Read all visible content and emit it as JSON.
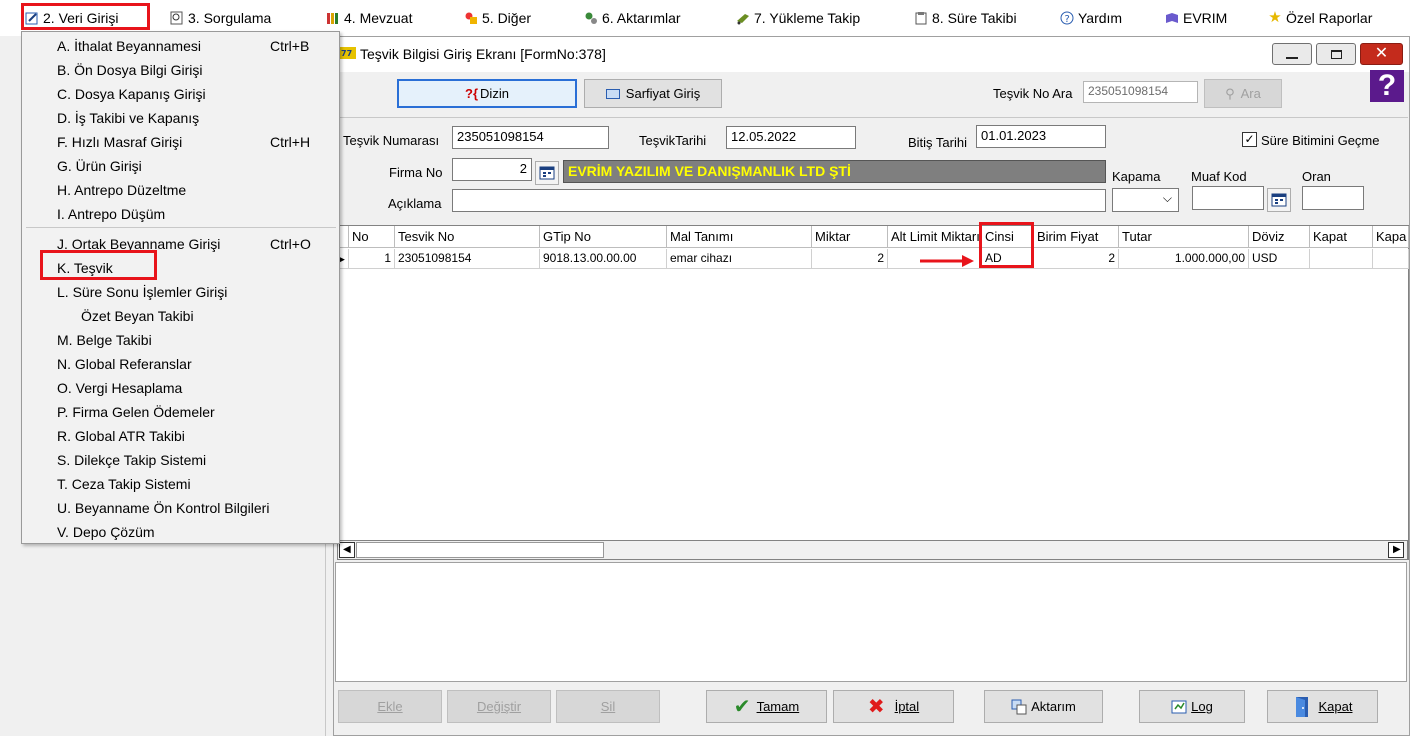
{
  "menubar": {
    "items": [
      {
        "label": "2.  Veri Girişi"
      },
      {
        "label": "3.  Sorgulama"
      },
      {
        "label": "4.  Mevzuat"
      },
      {
        "label": "5.  Diğer"
      },
      {
        "label": "6.  Aktarımlar"
      },
      {
        "label": "7.  Yükleme Takip"
      },
      {
        "label": "8. Süre Takibi"
      },
      {
        "label": "Yardım"
      },
      {
        "label": "EVRIM"
      },
      {
        "label": "Özel Raporlar"
      }
    ]
  },
  "dropdown": {
    "items": [
      {
        "label": "A.  İthalat Beyannamesi",
        "shortcut": "Ctrl+B"
      },
      {
        "label": "B.  Ön Dosya Bilgi Girişi",
        "shortcut": ""
      },
      {
        "label": "C.  Dosya Kapanış Girişi",
        "shortcut": ""
      },
      {
        "label": "D.  İş Takibi ve Kapanış",
        "shortcut": ""
      },
      {
        "label": "F.  Hızlı Masraf Girişi",
        "shortcut": "Ctrl+H"
      },
      {
        "label": "G.  Ürün Girişi",
        "shortcut": ""
      },
      {
        "label": "H.  Antrepo Düzeltme",
        "shortcut": ""
      },
      {
        "label": "I.  Antrepo Düşüm",
        "shortcut": ""
      },
      {
        "label": "J.  Ortak Beyanname Girişi",
        "shortcut": "Ctrl+O"
      },
      {
        "label": "K.  Teşvik",
        "shortcut": ""
      },
      {
        "label": "L.  Süre Sonu İşlemler Girişi",
        "shortcut": ""
      },
      {
        "label": "Özet Beyan Takibi",
        "shortcut": ""
      },
      {
        "label": "M.  Belge Takibi",
        "shortcut": ""
      },
      {
        "label": "N.  Global Referanslar",
        "shortcut": ""
      },
      {
        "label": "O. Vergi Hesaplama",
        "shortcut": ""
      },
      {
        "label": "P. Firma Gelen Ödemeler",
        "shortcut": ""
      },
      {
        "label": "R. Global ATR Takibi",
        "shortcut": ""
      },
      {
        "label": "S. Dilekçe Takip Sistemi",
        "shortcut": ""
      },
      {
        "label": "T. Ceza Takip Sistemi",
        "shortcut": ""
      },
      {
        "label": "U. Beyanname Ön Kontrol Bilgileri",
        "shortcut": ""
      },
      {
        "label": "V. Depo Çözüm",
        "shortcut": ""
      }
    ]
  },
  "window": {
    "title": "Teşvik Bilgisi Giriş Ekranı [FormNo:378]",
    "toolbar": {
      "dizin_label": "Dizin",
      "sarfiyat_label": "Sarfiyat Giriş",
      "search_label": "Teşvik No Ara",
      "search_value": "235051098154",
      "ara_label": "Ara"
    },
    "form": {
      "tesvik_numarasi_label": "Teşvik Numarası",
      "tesvik_numarasi_value": "235051098154",
      "tesvik_tarihi_label": "TeşvikTarihi",
      "tesvik_tarihi_value": "12.05.2022",
      "bitis_tarihi_label": "Bitiş Tarihi",
      "bitis_tarihi_value": "01.01.2023",
      "sure_checkbox_label": "Süre Bitimini Geçme",
      "sure_checked": true,
      "firma_no_label": "Firma No",
      "firma_no_value": "2",
      "firma_name": "EVRİM YAZILIM VE DANIŞMANLIK LTD ŞTİ",
      "aciklama_label": "Açıklama",
      "aciklama_value": "",
      "kapama_label": "Kapama",
      "kapama_value": "",
      "muaf_kod_label": "Muaf Kod",
      "muaf_kod_value": "",
      "oran_label": "Oran",
      "oran_value": ""
    },
    "grid": {
      "columns": [
        "No",
        "Tesvik No",
        "GTip No",
        "Mal Tanımı",
        "Miktar",
        "Alt Limit Miktarı",
        "Cinsi",
        "Birim Fiyat",
        "Tutar",
        "Döviz",
        "Kapat",
        "Kapa"
      ],
      "rows": [
        [
          "1",
          "23051098154",
          "9018.13.00.00.00",
          "emar cihazı",
          "2",
          "",
          "AD",
          "2",
          "1.000.000,00",
          "USD",
          "",
          ""
        ]
      ]
    },
    "buttons": {
      "ekle": "Ekle",
      "degistir": "Değiştir",
      "sil": "Sil",
      "tamam": "Tamam",
      "iptal": "İptal",
      "aktarim": "Aktarım",
      "log": "Log",
      "kapat": "Kapat"
    }
  },
  "colors": {
    "highlight_red": "#e8141b",
    "firma_bg": "#7f7f7f",
    "firma_text": "#ffff00",
    "close_red": "#c42b1c",
    "help_purple": "#5b1a8c"
  }
}
